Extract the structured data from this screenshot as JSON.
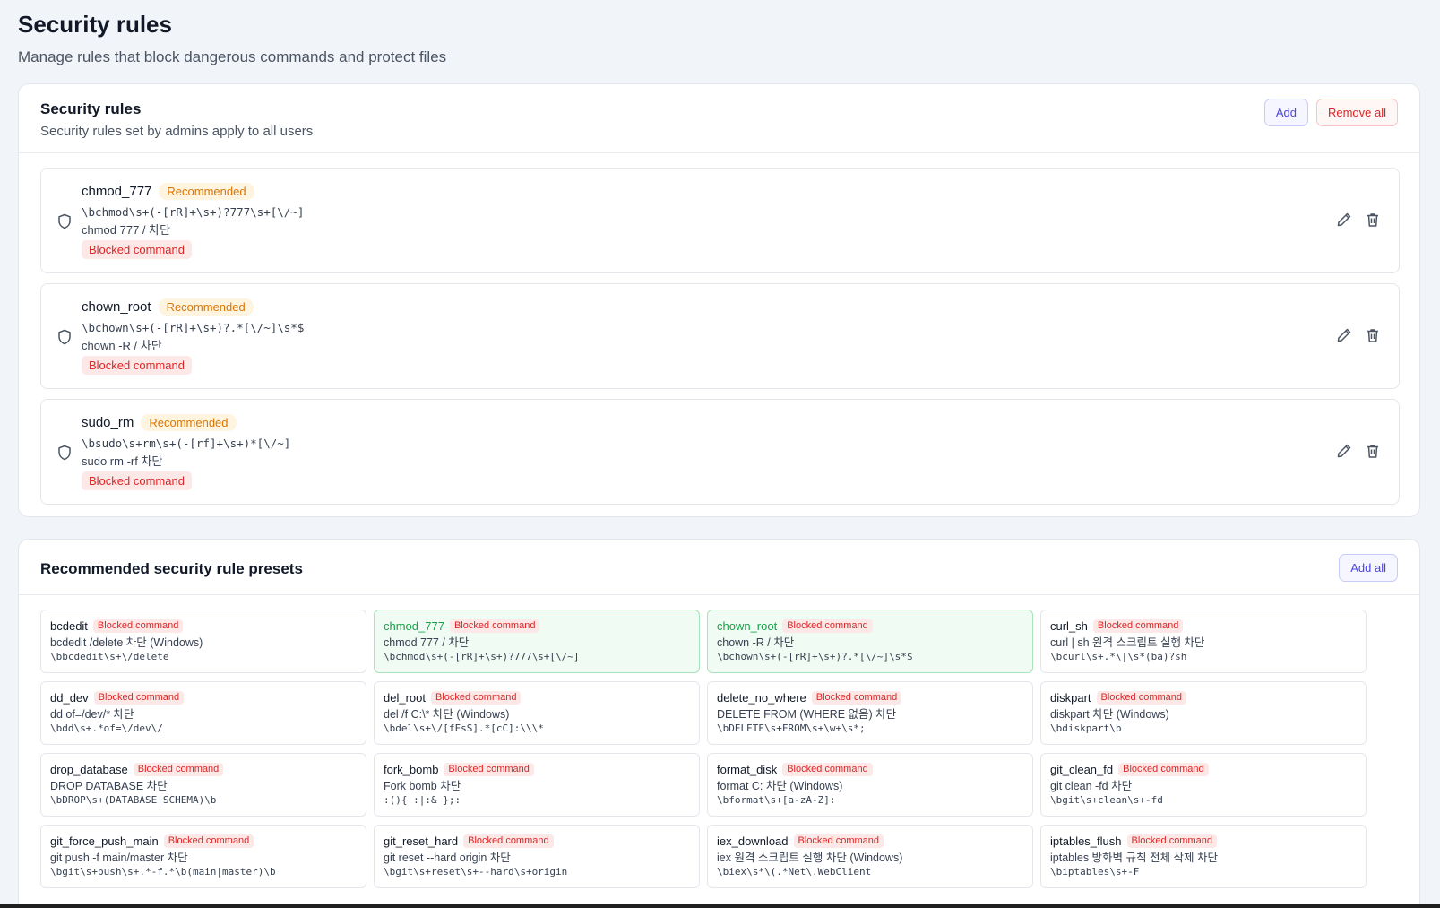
{
  "page": {
    "title": "Security rules",
    "subtitle": "Manage rules that block dangerous commands and protect files"
  },
  "rules_card": {
    "title": "Security rules",
    "description": "Security rules set by admins apply to all users",
    "add_label": "Add",
    "remove_all_label": "Remove all",
    "rules": [
      {
        "name": "chmod_777",
        "badge": "Recommended",
        "pattern": "\\bchmod\\s+(-[rR]+\\s+)?777\\s+[\\/~]",
        "desc": "chmod 777 / 차단",
        "type": "Blocked command"
      },
      {
        "name": "chown_root",
        "badge": "Recommended",
        "pattern": "\\bchown\\s+(-[rR]+\\s+)?.*[\\/~]\\s*$",
        "desc": "chown -R / 차단",
        "type": "Blocked command"
      },
      {
        "name": "sudo_rm",
        "badge": "Recommended",
        "pattern": "\\bsudo\\s+rm\\s+(-[rf]+\\s+)*[\\/~]",
        "desc": "sudo rm -rf 차단",
        "type": "Blocked command"
      }
    ]
  },
  "presets_card": {
    "title": "Recommended security rule presets",
    "add_all_label": "Add all",
    "presets": [
      {
        "name": "bcdedit",
        "badge": "Blocked command",
        "desc": "bcdedit /delete 차단 (Windows)",
        "pattern": "\\bbcdedit\\s+\\/delete",
        "added": false
      },
      {
        "name": "chmod_777",
        "badge": "Blocked command",
        "desc": "chmod 777 / 차단",
        "pattern": "\\bchmod\\s+(-[rR]+\\s+)?777\\s+[\\/~]",
        "added": true
      },
      {
        "name": "chown_root",
        "badge": "Blocked command",
        "desc": "chown -R / 차단",
        "pattern": "\\bchown\\s+(-[rR]+\\s+)?.*[\\/~]\\s*$",
        "added": true
      },
      {
        "name": "curl_sh",
        "badge": "Blocked command",
        "desc": "curl | sh 원격 스크립트 실행 차단",
        "pattern": "\\bcurl\\s+.*\\|\\s*(ba)?sh",
        "added": false
      },
      {
        "name": "dd_dev",
        "badge": "Blocked command",
        "desc": "dd of=/dev/* 차단",
        "pattern": "\\bdd\\s+.*of=\\/dev\\/",
        "added": false
      },
      {
        "name": "del_root",
        "badge": "Blocked command",
        "desc": "del /f C:\\* 차단 (Windows)",
        "pattern": "\\bdel\\s+\\/[fFsS].*[cC]:\\\\\\*",
        "added": false
      },
      {
        "name": "delete_no_where",
        "badge": "Blocked command",
        "desc": "DELETE FROM (WHERE 없음) 차단",
        "pattern": "\\bDELETE\\s+FROM\\s+\\w+\\s*;",
        "added": false
      },
      {
        "name": "diskpart",
        "badge": "Blocked command",
        "desc": "diskpart 차단 (Windows)",
        "pattern": "\\bdiskpart\\b",
        "added": false
      },
      {
        "name": "drop_database",
        "badge": "Blocked command",
        "desc": "DROP DATABASE 차단",
        "pattern": "\\bDROP\\s+(DATABASE|SCHEMA)\\b",
        "added": false
      },
      {
        "name": "fork_bomb",
        "badge": "Blocked command",
        "desc": "Fork bomb 차단",
        "pattern": ":(){ :|:& };:",
        "added": false
      },
      {
        "name": "format_disk",
        "badge": "Blocked command",
        "desc": "format C: 차단 (Windows)",
        "pattern": "\\bformat\\s+[a-zA-Z]:",
        "added": false
      },
      {
        "name": "git_clean_fd",
        "badge": "Blocked command",
        "desc": "git clean -fd 차단",
        "pattern": "\\bgit\\s+clean\\s+-fd",
        "added": false
      },
      {
        "name": "git_force_push_main",
        "badge": "Blocked command",
        "desc": "git push -f main/master 차단",
        "pattern": "\\bgit\\s+push\\s+.*-f.*\\b(main|master)\\b",
        "added": false
      },
      {
        "name": "git_reset_hard",
        "badge": "Blocked command",
        "desc": "git reset --hard origin 차단",
        "pattern": "\\bgit\\s+reset\\s+--hard\\s+origin",
        "added": false
      },
      {
        "name": "iex_download",
        "badge": "Blocked command",
        "desc": "iex 원격 스크립트 실행 차단 (Windows)",
        "pattern": "\\biex\\s*\\(.*Net\\.WebClient",
        "added": false
      },
      {
        "name": "iptables_flush",
        "badge": "Blocked command",
        "desc": "iptables 방화벽 규칙 전체 삭제 차단",
        "pattern": "\\biptables\\s+-F",
        "added": false
      }
    ]
  },
  "colors": {
    "accent": "#4f46e5",
    "danger": "#dc2626",
    "recommended": "#d97706",
    "added": "#16a34a"
  }
}
